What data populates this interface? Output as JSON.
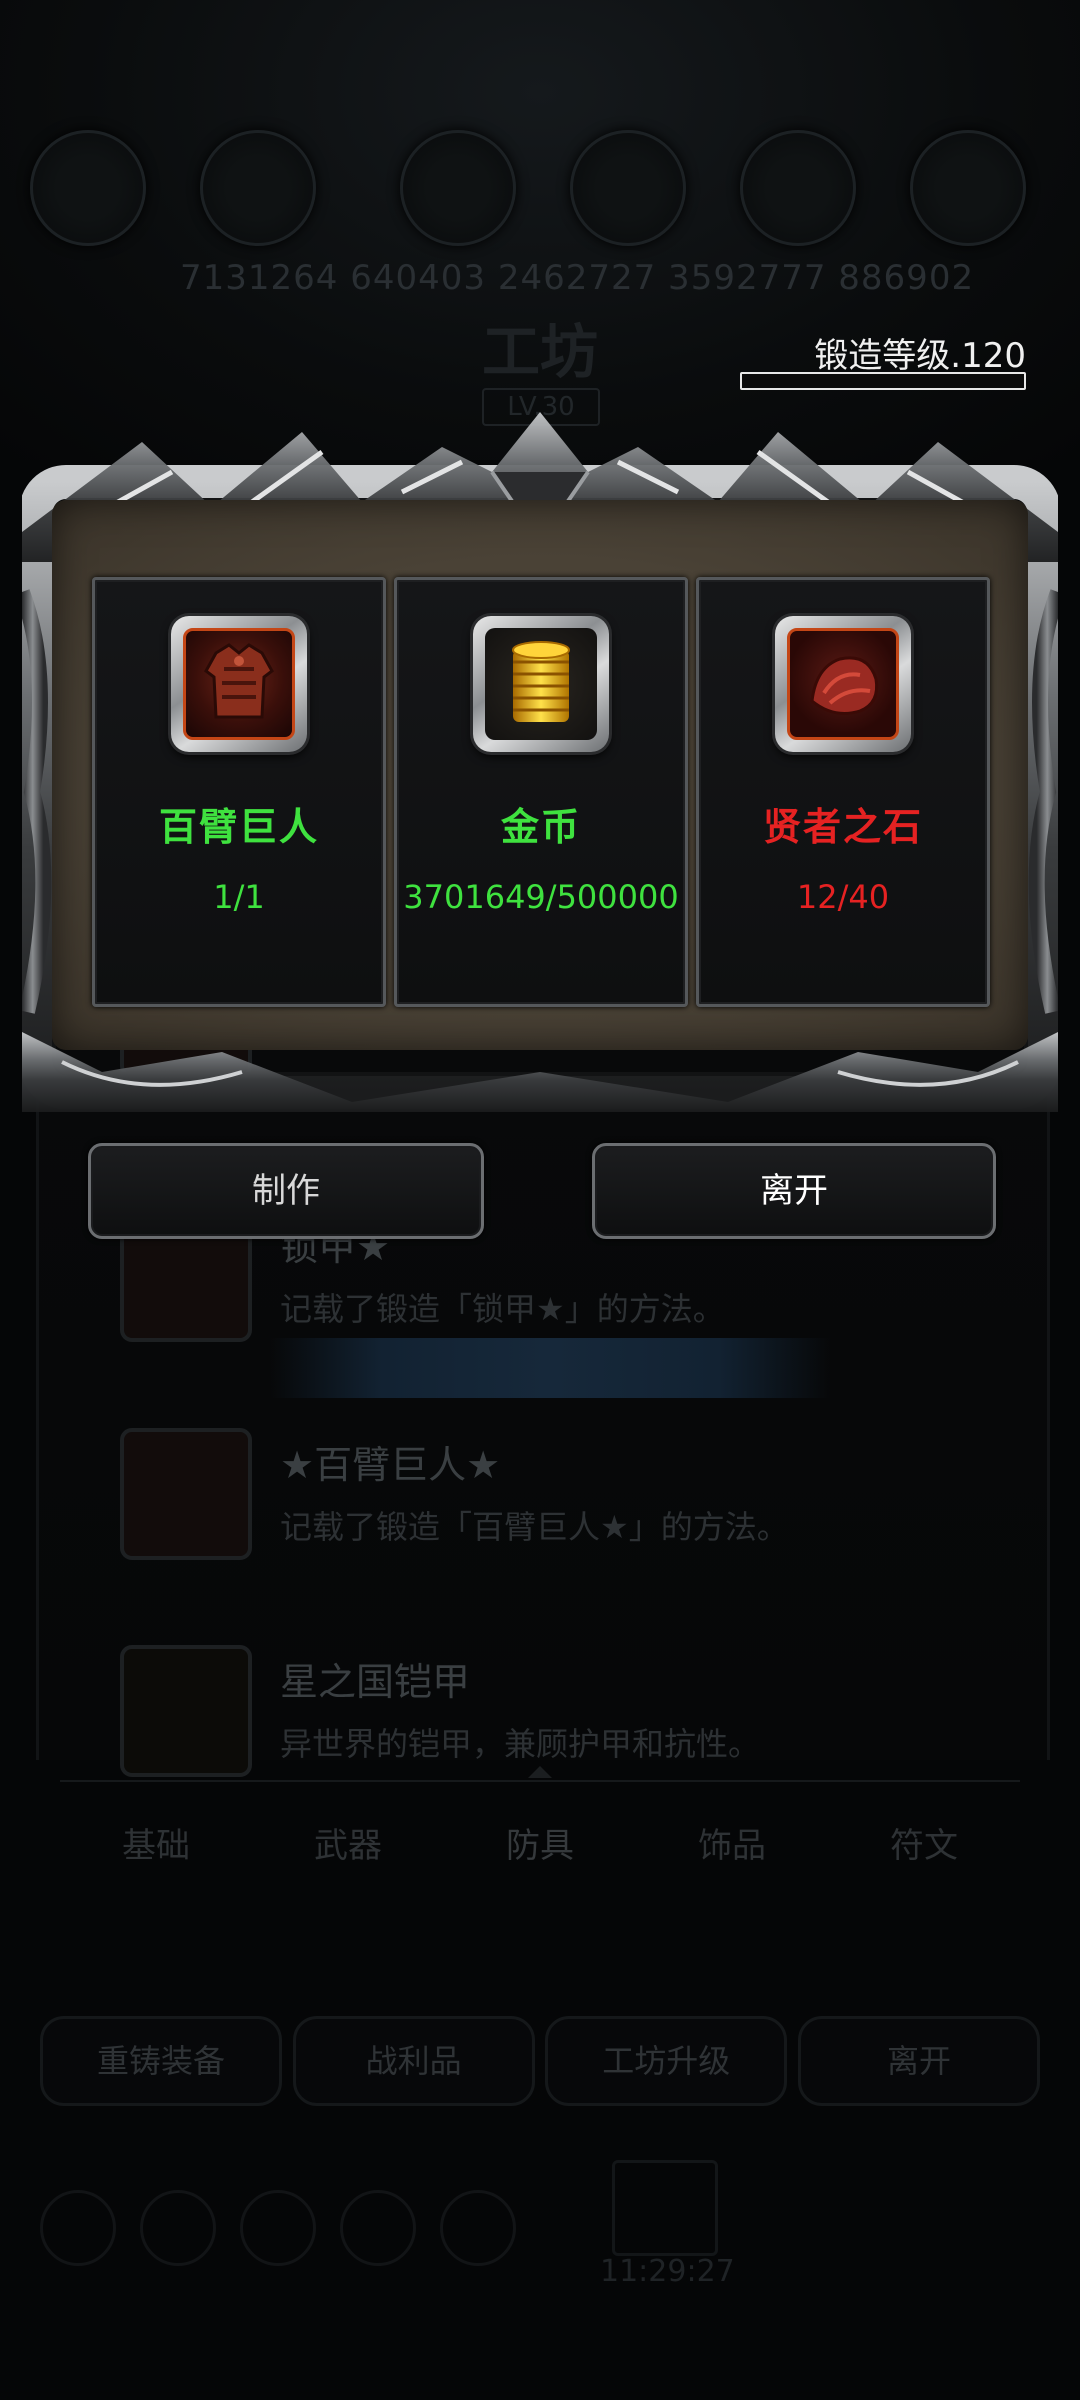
{
  "background": {
    "stats_text": "7131264  640403  2462727  3592777  886902",
    "workshop_title": "工坊",
    "workshop_level": "LV.30",
    "forge_level_label": "锻造等级.120",
    "forge_level_progress": 0.0,
    "recipes": [
      {
        "name": "锁甲★",
        "desc": "记载了锻造「锁甲★」的方法。"
      },
      {
        "name": "★百臂巨人★",
        "desc": "记载了锻造「百臂巨人★」的方法。"
      },
      {
        "name": "星之国铠甲",
        "desc": "异世界的铠甲，兼顾护甲和抗性。"
      }
    ],
    "tabs": [
      "基础",
      "武器",
      "防具",
      "饰品",
      "符文"
    ],
    "active_tab": "防具",
    "bottom_buttons": [
      "重铸装备",
      "战利品",
      "工坊升级",
      "离开"
    ],
    "dock_time": "11:29:27"
  },
  "dialog": {
    "materials": [
      {
        "name": "百臂巨人",
        "count": "1/1",
        "icon": "armor-icon",
        "color": "#3fe23f"
      },
      {
        "name": "金币",
        "count": "3701649/500000",
        "icon": "gold-coins-icon",
        "color": "#3fe23f"
      },
      {
        "name": "贤者之石",
        "count": "12/40",
        "icon": "philosopher-stone-icon",
        "color": "#e62222"
      }
    ],
    "craft_button": "制作",
    "leave_button": "离开"
  }
}
